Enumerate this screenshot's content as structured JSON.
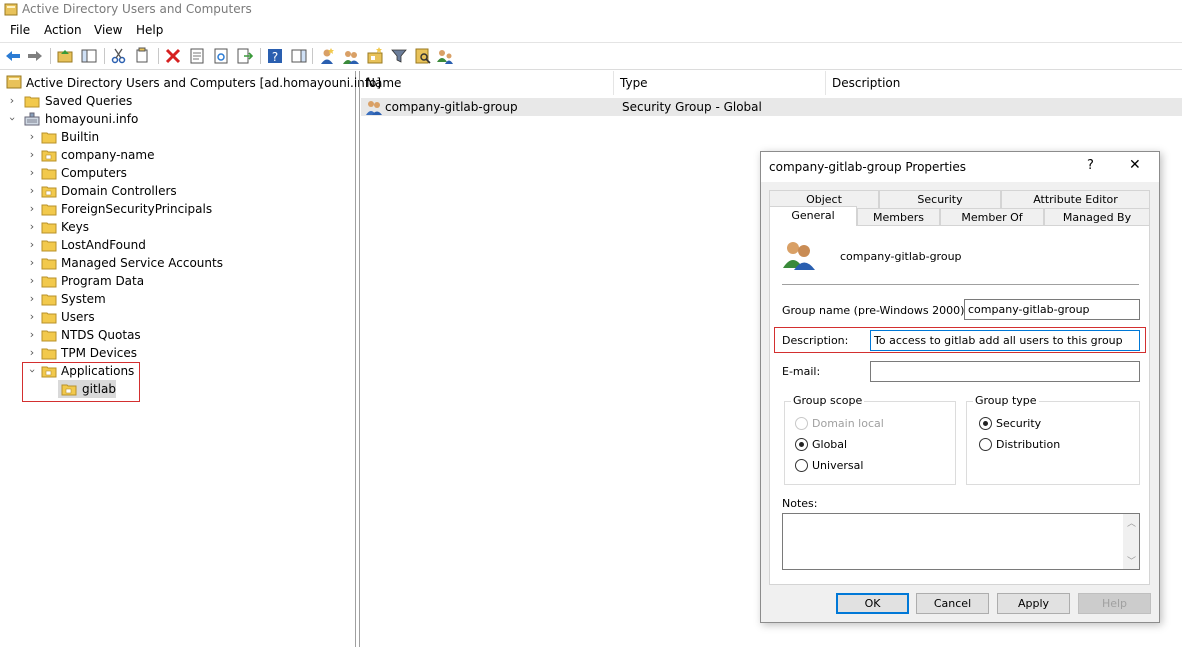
{
  "window": {
    "title": "Active Directory Users and Computers"
  },
  "menu": [
    "File",
    "Action",
    "View",
    "Help"
  ],
  "toolbar": {
    "icons": [
      "back-arrow-icon",
      "forward-arrow-icon",
      "up-folder-icon",
      "show-hide-console-tree-icon",
      "cut-icon",
      "copy-icon",
      "delete-icon",
      "properties-icon",
      "refresh-icon",
      "export-list-icon",
      "help-icon",
      "action-pane-icon",
      "new-user-icon",
      "new-group-icon",
      "new-ou-icon",
      "filter-icon",
      "find-icon",
      "add-to-group-icon"
    ]
  },
  "tree": {
    "root": "Active Directory Users and Computers [ad.homayouni.info]",
    "saved_queries": "Saved Queries",
    "domain": "homayouni.info",
    "items": [
      "Builtin",
      "company-name",
      "Computers",
      "Domain Controllers",
      "ForeignSecurityPrincipals",
      "Keys",
      "LostAndFound",
      "Managed Service Accounts",
      "Program Data",
      "System",
      "Users",
      "NTDS Quotas",
      "TPM Devices"
    ],
    "applications": "Applications",
    "gitlab": "gitlab"
  },
  "list": {
    "columns": [
      "Name",
      "Type",
      "Description"
    ],
    "rows": [
      {
        "name": "company-gitlab-group",
        "type": "Security Group - Global",
        "description": ""
      }
    ]
  },
  "dialog": {
    "title": "company-gitlab-group Properties",
    "help_glyph": "?",
    "close_glyph": "✕",
    "tabs_back": [
      "Object",
      "Security",
      "Attribute Editor"
    ],
    "tabs_front": [
      "General",
      "Members",
      "Member Of",
      "Managed By"
    ],
    "group_display_name": "company-gitlab-group",
    "fields": {
      "group_name_label": "Group name (pre-Windows 2000):",
      "group_name_value": "company-gitlab-group",
      "description_label": "Description:",
      "description_value": "To access to gitlab add all users to this group",
      "email_label": "E-mail:",
      "email_value": ""
    },
    "group_scope": {
      "title": "Group scope",
      "options": [
        "Domain local",
        "Global",
        "Universal"
      ],
      "selected": "Global"
    },
    "group_type": {
      "title": "Group type",
      "options": [
        "Security",
        "Distribution"
      ],
      "selected": "Security"
    },
    "notes_label": "Notes:",
    "buttons": {
      "ok": "OK",
      "cancel": "Cancel",
      "apply": "Apply",
      "help": "Help"
    }
  },
  "colors": {
    "highlight_red": "#d32f2f",
    "accent_blue": "#0078d7",
    "folder_yellow": "#f2c94c"
  }
}
